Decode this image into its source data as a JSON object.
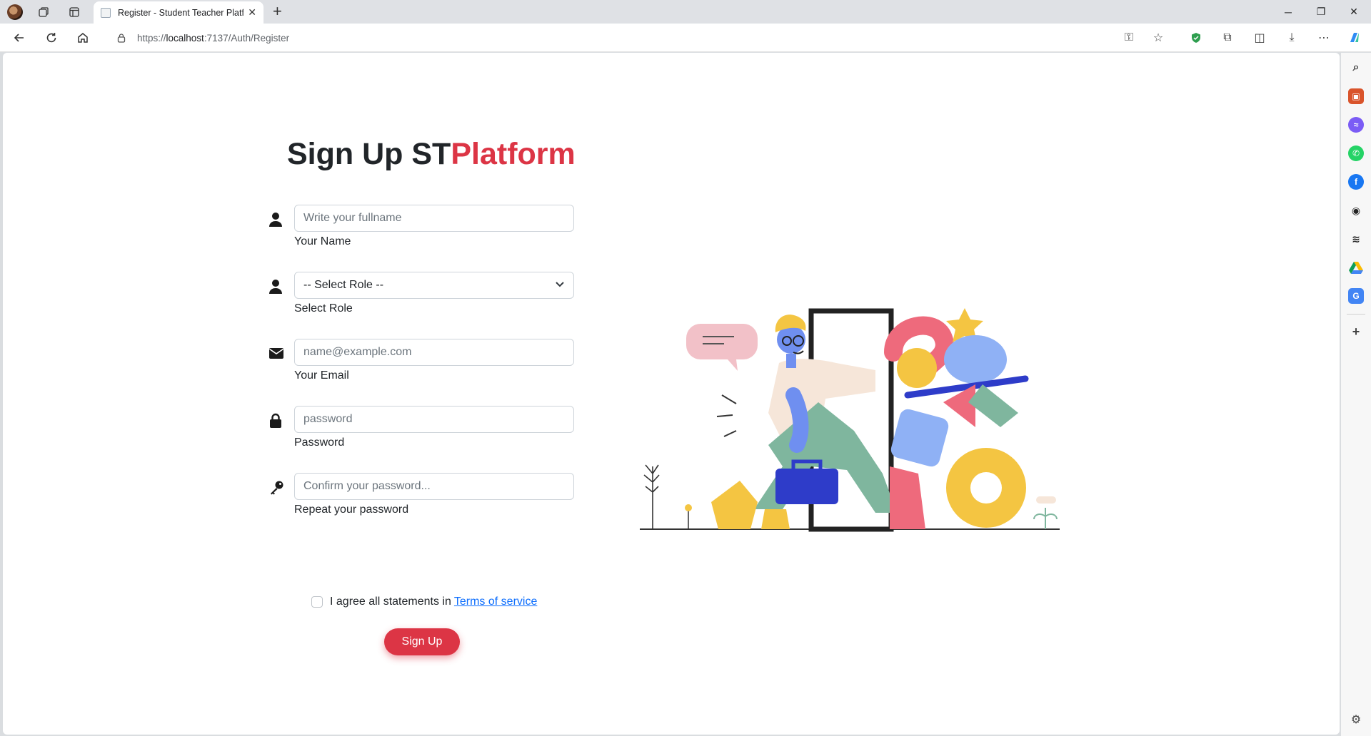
{
  "browser": {
    "tab_title": "Register - Student Teacher Platfor",
    "url_scheme": "https://",
    "url_host": "localhost",
    "url_rest": ":7137/Auth/Register"
  },
  "page": {
    "heading_main": "Sign Up ST",
    "heading_accent": "Platform",
    "accent_color": "#dc3545",
    "fields": {
      "name": {
        "placeholder": "Write your fullname",
        "label": "Your Name",
        "icon": "user-icon"
      },
      "role": {
        "selected": "-- Select Role --",
        "label": "Select Role",
        "icon": "user-icon"
      },
      "email": {
        "placeholder": "name@example.com",
        "label": "Your Email",
        "icon": "envelope-icon"
      },
      "password": {
        "placeholder": "password",
        "label": "Password",
        "icon": "lock-icon"
      },
      "confirm": {
        "placeholder": "Confirm your password...",
        "label": "Repeat your password",
        "icon": "key-icon"
      }
    },
    "agree_text": "I agree all statements in",
    "terms_link": "Terms of service",
    "submit_label": "Sign Up"
  }
}
